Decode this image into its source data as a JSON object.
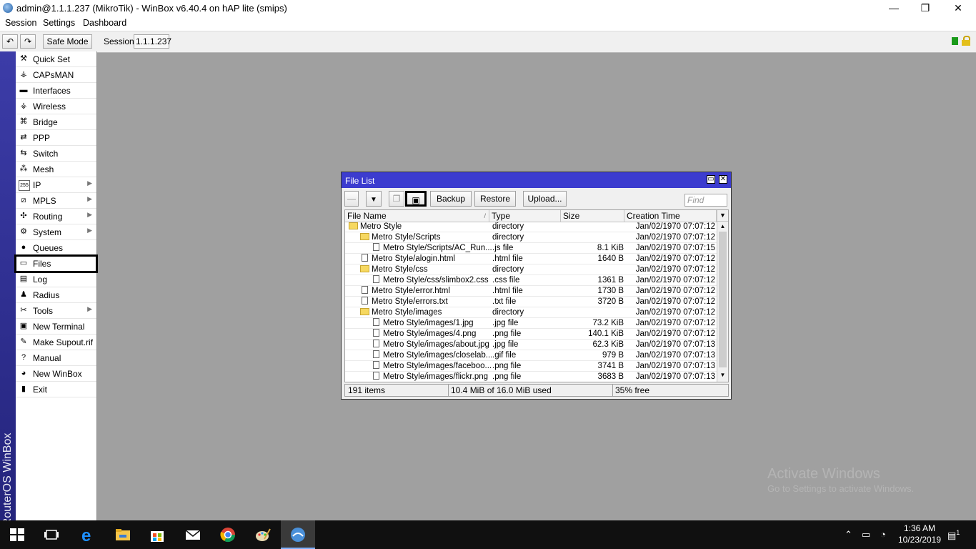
{
  "window": {
    "title": "admin@1.1.1.237 (MikroTik) - WinBox v6.40.4 on hAP lite (smips)",
    "minimize": "—",
    "maximize": "❐",
    "close": "✕"
  },
  "menu": [
    "Session",
    "Settings",
    "Dashboard"
  ],
  "toolbar": {
    "undo_icon": "↶",
    "redo_icon": "↷",
    "safe_mode": "Safe Mode",
    "session_label": "Session:",
    "session_value": "1.1.1.237",
    "status_color": "#1a9a1a"
  },
  "vertical_brand": "RouterOS WinBox",
  "sidebar": {
    "items": [
      {
        "label": "Quick Set",
        "icon": "quickset-icon",
        "glyph": "⚒",
        "arrow": false
      },
      {
        "label": "CAPsMAN",
        "icon": "antenna-icon",
        "glyph": "⚶",
        "arrow": false
      },
      {
        "label": "Interfaces",
        "icon": "interfaces-icon",
        "glyph": "▬",
        "arrow": false
      },
      {
        "label": "Wireless",
        "icon": "wireless-icon",
        "glyph": "⚶",
        "arrow": false
      },
      {
        "label": "Bridge",
        "icon": "bridge-icon",
        "glyph": "⌘",
        "arrow": false
      },
      {
        "label": "PPP",
        "icon": "ppp-icon",
        "glyph": "⇄",
        "arrow": false
      },
      {
        "label": "Switch",
        "icon": "switch-icon",
        "glyph": "⇆",
        "arrow": false
      },
      {
        "label": "Mesh",
        "icon": "mesh-icon",
        "glyph": "⁂",
        "arrow": false
      },
      {
        "label": "IP",
        "icon": "ip-icon",
        "glyph": "255",
        "arrow": true
      },
      {
        "label": "MPLS",
        "icon": "mpls-icon",
        "glyph": "⧄",
        "arrow": true
      },
      {
        "label": "Routing",
        "icon": "routing-icon",
        "glyph": "✣",
        "arrow": true
      },
      {
        "label": "System",
        "icon": "gear-icon",
        "glyph": "⚙",
        "arrow": true
      },
      {
        "label": "Queues",
        "icon": "queues-icon",
        "glyph": "●",
        "arrow": false
      },
      {
        "label": "Files",
        "icon": "folder-icon",
        "glyph": "▭",
        "arrow": false,
        "selected": true
      },
      {
        "label": "Log",
        "icon": "log-icon",
        "glyph": "▤",
        "arrow": false
      },
      {
        "label": "Radius",
        "icon": "radius-icon",
        "glyph": "♟",
        "arrow": false
      },
      {
        "label": "Tools",
        "icon": "tools-icon",
        "glyph": "✂",
        "arrow": true
      },
      {
        "label": "New Terminal",
        "icon": "terminal-icon",
        "glyph": "▣",
        "arrow": false
      },
      {
        "label": "Make Supout.rif",
        "icon": "supout-icon",
        "glyph": "✎",
        "arrow": false
      },
      {
        "label": "Manual",
        "icon": "help-icon",
        "glyph": "?",
        "arrow": false
      },
      {
        "label": "New WinBox",
        "icon": "winbox-icon",
        "glyph": "◕",
        "arrow": false
      },
      {
        "label": "Exit",
        "icon": "exit-icon",
        "glyph": "▮",
        "arrow": false
      }
    ]
  },
  "file_list": {
    "title": "File List",
    "buttons": {
      "remove": "—",
      "filter": "▼",
      "copy": "❐",
      "paste": "▣",
      "backup": "Backup",
      "restore": "Restore",
      "upload": "Upload..."
    },
    "find_placeholder": "Find",
    "columns": [
      "File Name",
      "Type",
      "Size",
      "Creation Time"
    ],
    "rows": [
      {
        "name": "Metro Style",
        "type": "directory",
        "size": "",
        "date": "Jan/02/1970 07:07:12",
        "kind": "folder",
        "indent": 0
      },
      {
        "name": "Metro Style/Scripts",
        "type": "directory",
        "size": "",
        "date": "Jan/02/1970 07:07:12",
        "kind": "folder",
        "indent": 1
      },
      {
        "name": "Metro Style/Scripts/AC_Run...",
        "type": ".js file",
        "size": "8.1 KiB",
        "date": "Jan/02/1970 07:07:15",
        "kind": "file",
        "indent": 2
      },
      {
        "name": "Metro Style/alogin.html",
        "type": ".html file",
        "size": "1640 B",
        "date": "Jan/02/1970 07:07:12",
        "kind": "file",
        "indent": 1
      },
      {
        "name": "Metro Style/css",
        "type": "directory",
        "size": "",
        "date": "Jan/02/1970 07:07:12",
        "kind": "folder",
        "indent": 1
      },
      {
        "name": "Metro Style/css/slimbox2.css",
        "type": ".css file",
        "size": "1361 B",
        "date": "Jan/02/1970 07:07:12",
        "kind": "file",
        "indent": 2
      },
      {
        "name": "Metro Style/error.html",
        "type": ".html file",
        "size": "1730 B",
        "date": "Jan/02/1970 07:07:12",
        "kind": "file",
        "indent": 1
      },
      {
        "name": "Metro Style/errors.txt",
        "type": ".txt file",
        "size": "3720 B",
        "date": "Jan/02/1970 07:07:12",
        "kind": "file",
        "indent": 1
      },
      {
        "name": "Metro Style/images",
        "type": "directory",
        "size": "",
        "date": "Jan/02/1970 07:07:12",
        "kind": "folder",
        "indent": 1
      },
      {
        "name": "Metro Style/images/1.jpg",
        "type": ".jpg file",
        "size": "73.2 KiB",
        "date": "Jan/02/1970 07:07:12",
        "kind": "file",
        "indent": 2
      },
      {
        "name": "Metro Style/images/4.png",
        "type": ".png file",
        "size": "140.1 KiB",
        "date": "Jan/02/1970 07:07:12",
        "kind": "file",
        "indent": 2
      },
      {
        "name": "Metro Style/images/about.jpg",
        "type": ".jpg file",
        "size": "62.3 KiB",
        "date": "Jan/02/1970 07:07:13",
        "kind": "file",
        "indent": 2
      },
      {
        "name": "Metro Style/images/closelab...",
        "type": ".gif file",
        "size": "979 B",
        "date": "Jan/02/1970 07:07:13",
        "kind": "file",
        "indent": 2
      },
      {
        "name": "Metro Style/images/faceboo...",
        "type": ".png file",
        "size": "3741 B",
        "date": "Jan/02/1970 07:07:13",
        "kind": "file",
        "indent": 2
      },
      {
        "name": "Metro Style/images/flickr.png",
        "type": ".png file",
        "size": "3683 B",
        "date": "Jan/02/1970 07:07:13",
        "kind": "file",
        "indent": 2
      }
    ],
    "status": {
      "items": "191 items",
      "used": "10.4 MiB of 16.0 MiB used",
      "free": "35% free"
    }
  },
  "watermark": {
    "line1": "Activate Windows",
    "line2": "Go to Settings to activate Windows."
  },
  "taskbar": {
    "time": "1:36 AM",
    "date": "10/23/2019",
    "notification_count": "1"
  }
}
